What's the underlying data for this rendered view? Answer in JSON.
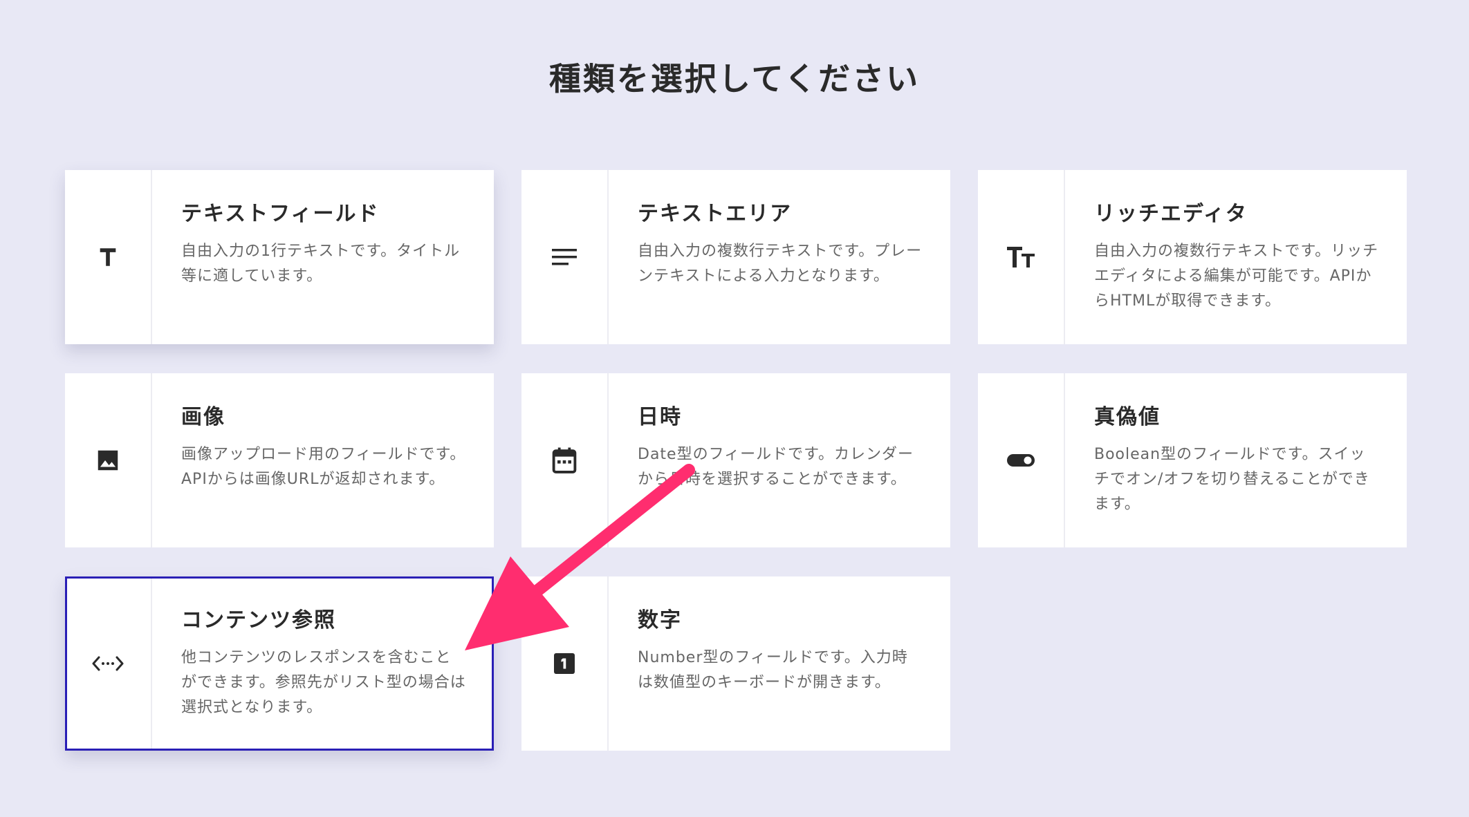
{
  "page": {
    "title": "種類を選択してください"
  },
  "cards": [
    {
      "title": "テキストフィールド",
      "description": "自由入力の1行テキストです。タイトル等に適しています。",
      "icon": "text-t-icon"
    },
    {
      "title": "テキストエリア",
      "description": "自由入力の複数行テキストです。プレーンテキストによる入力となります。",
      "icon": "lines-icon"
    },
    {
      "title": "リッチエディタ",
      "description": "自由入力の複数行テキストです。リッチエディタによる編集が可能です。APIからHTMLが取得できます。",
      "icon": "text-size-icon"
    },
    {
      "title": "画像",
      "description": "画像アップロード用のフィールドです。APIからは画像URLが返却されます。",
      "icon": "image-icon"
    },
    {
      "title": "日時",
      "description": "Date型のフィールドです。カレンダーから日時を選択することができます。",
      "icon": "calendar-icon"
    },
    {
      "title": "真偽値",
      "description": "Boolean型のフィールドです。スイッチでオン/オフを切り替えることができます。",
      "icon": "toggle-icon"
    },
    {
      "title": "コンテンツ参照",
      "description": "他コンテンツのレスポンスを含むことができます。参照先がリスト型の場合は選択式となります。",
      "icon": "code-brackets-icon",
      "selected": true
    },
    {
      "title": "数字",
      "description": "Number型のフィールドです。入力時は数値型のキーボードが開きます。",
      "icon": "number-one-icon"
    }
  ],
  "colors": {
    "background": "#e8e8f5",
    "selected_border": "#2a1fb6",
    "arrow": "#ff2d6f"
  }
}
